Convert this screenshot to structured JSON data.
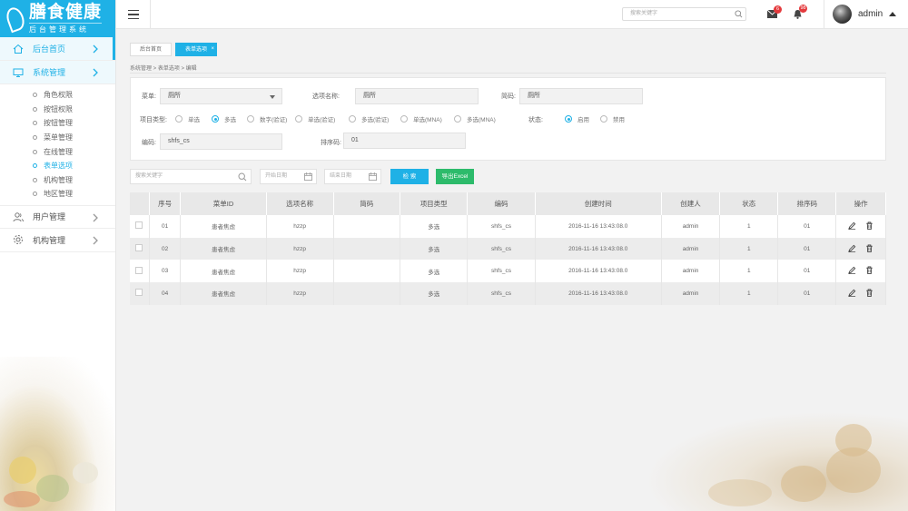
{
  "brand": {
    "title": "膳食健康",
    "subtitle": "后台管理系统",
    "accent": "#1fb1e6"
  },
  "sidebar": {
    "items": [
      {
        "label": "后台首页",
        "icon": "home-icon"
      },
      {
        "label": "系统管理",
        "icon": "monitor-icon"
      },
      {
        "label": "用户管理",
        "icon": "users-icon"
      },
      {
        "label": "机构管理",
        "icon": "gear-icon"
      }
    ],
    "sub_items": [
      "角色权限",
      "按钮权限",
      "按钮管理",
      "菜单管理",
      "在线管理",
      "表单选项",
      "机构管理",
      "地区管理"
    ]
  },
  "header": {
    "search_placeholder": "搜索关键字",
    "mail_count": "6",
    "bell_count": "98",
    "username": "admin"
  },
  "tabs": [
    {
      "label": "后台首页"
    },
    {
      "label": "表单选项",
      "close": "×"
    }
  ],
  "breadcrumb": "系统管理 > 表单选项 > 编辑",
  "form": {
    "menu_label": "菜单:",
    "menu_value": "厕所",
    "option_name_label": "选项名称:",
    "option_name_value": "厕所",
    "short_code_label": "简码:",
    "short_code_value": "厕所",
    "item_type_label": "项目类型:",
    "item_types": [
      "单选",
      "多选",
      "数字(验证)",
      "单选(验证)",
      "多选(验证)",
      "单选(MNA)",
      "多选(MNA)"
    ],
    "item_type_selected": 1,
    "status_label": "状态:",
    "statuses": [
      "启用",
      "禁用"
    ],
    "status_selected": 0,
    "code_label": "编码:",
    "code_value": "shfs_cs",
    "sort_label": "排序码:",
    "sort_value": "01"
  },
  "filter": {
    "search_placeholder": "搜索关键字",
    "start_date": "开始日期",
    "end_date": "结束日期",
    "search_button": "检 索",
    "export_button": "导出Excel"
  },
  "table": {
    "columns": [
      "序号",
      "菜单ID",
      "选项名称",
      "简码",
      "项目类型",
      "编码",
      "创建时间",
      "创建人",
      "状态",
      "排序码",
      "操作"
    ],
    "rows": [
      [
        "01",
        "患者焦虑",
        "hzzp",
        "",
        "多选",
        "shfs_cs",
        "2016-11-16 13:43:08.0",
        "admin",
        "1",
        "01"
      ],
      [
        "02",
        "患者焦虑",
        "hzzp",
        "",
        "多选",
        "shfs_cs",
        "2016-11-16 13:43:08.0",
        "admin",
        "1",
        "01"
      ],
      [
        "03",
        "患者焦虑",
        "hzzp",
        "",
        "多选",
        "shfs_cs",
        "2016-11-16 13:43:08.0",
        "admin",
        "1",
        "01"
      ],
      [
        "04",
        "患者焦虑",
        "hzzp",
        "",
        "多选",
        "shfs_cs",
        "2016-11-16 13:43:08.0",
        "admin",
        "1",
        "01"
      ]
    ]
  },
  "colors": {
    "search_button": "#1fb1e6",
    "export_button": "#2dbb6b",
    "badge": "#e4393c"
  }
}
